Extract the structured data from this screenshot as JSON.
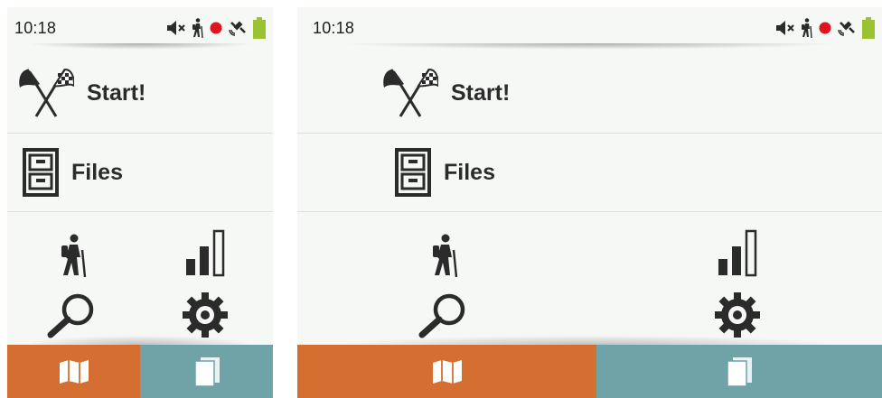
{
  "status": {
    "time": "10:18"
  },
  "menu": {
    "start_label": "Start!",
    "files_label": "Files"
  },
  "icons": {
    "statusbar": [
      "speaker-muted-icon",
      "hiker-icon",
      "recording-dot-icon",
      "satellite-icon",
      "battery-icon"
    ],
    "start": "checkered-flags-icon",
    "files": "file-cabinet-icon",
    "grid": [
      "hiker-icon",
      "signal-bars-icon",
      "magnifier-icon",
      "gear-icon"
    ],
    "tabs": [
      "map-icon",
      "pages-icon"
    ]
  },
  "colors": {
    "background": "#f5f8f5",
    "map_tab": "#d56f31",
    "pages_tab": "#6fa3a8",
    "recording": "#e0141e",
    "battery": "#9bc232",
    "icon": "#2b2b2b"
  }
}
